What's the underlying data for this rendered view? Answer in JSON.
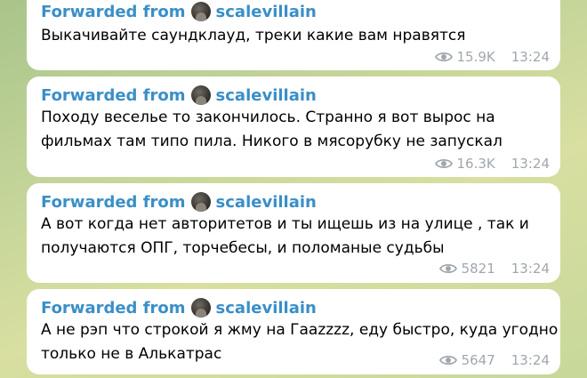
{
  "forwarded_prefix": "Forwarded from",
  "messages": [
    {
      "author": "scalevillain",
      "lines": [
        "Выкачивайте саундклауд, треки какие вам нравятся"
      ],
      "views": "15.9K",
      "time": "13:24"
    },
    {
      "author": "scalevillain",
      "lines": [
        "Походу веселье то закончилось. Странно я вот вырос на",
        "фильмах там типо пила. Никого в мясорубку не запускал"
      ],
      "views": "16.3K",
      "time": "13:24"
    },
    {
      "author": "scalevillain",
      "lines": [
        "А вот когда нет авторитетов и ты ищешь из на улице , так и",
        "получаются ОПГ, торчебесы, и поломаные судьбы"
      ],
      "views": "5821",
      "time": "13:24"
    },
    {
      "author": "scalevillain",
      "lines": [
        "А не рэп что строкой я жму на Гааzzzz, еду быстро, куда угодно",
        "только не в Алькатрас"
      ],
      "views": "5647",
      "time": "13:24"
    }
  ],
  "icons": {
    "views": "eye-icon",
    "channel_avatar": "avatar"
  },
  "colors": {
    "link_blue": "#3a8fc7",
    "meta_gray": "#a0a7ad",
    "bubble_bg": "#ffffff"
  }
}
